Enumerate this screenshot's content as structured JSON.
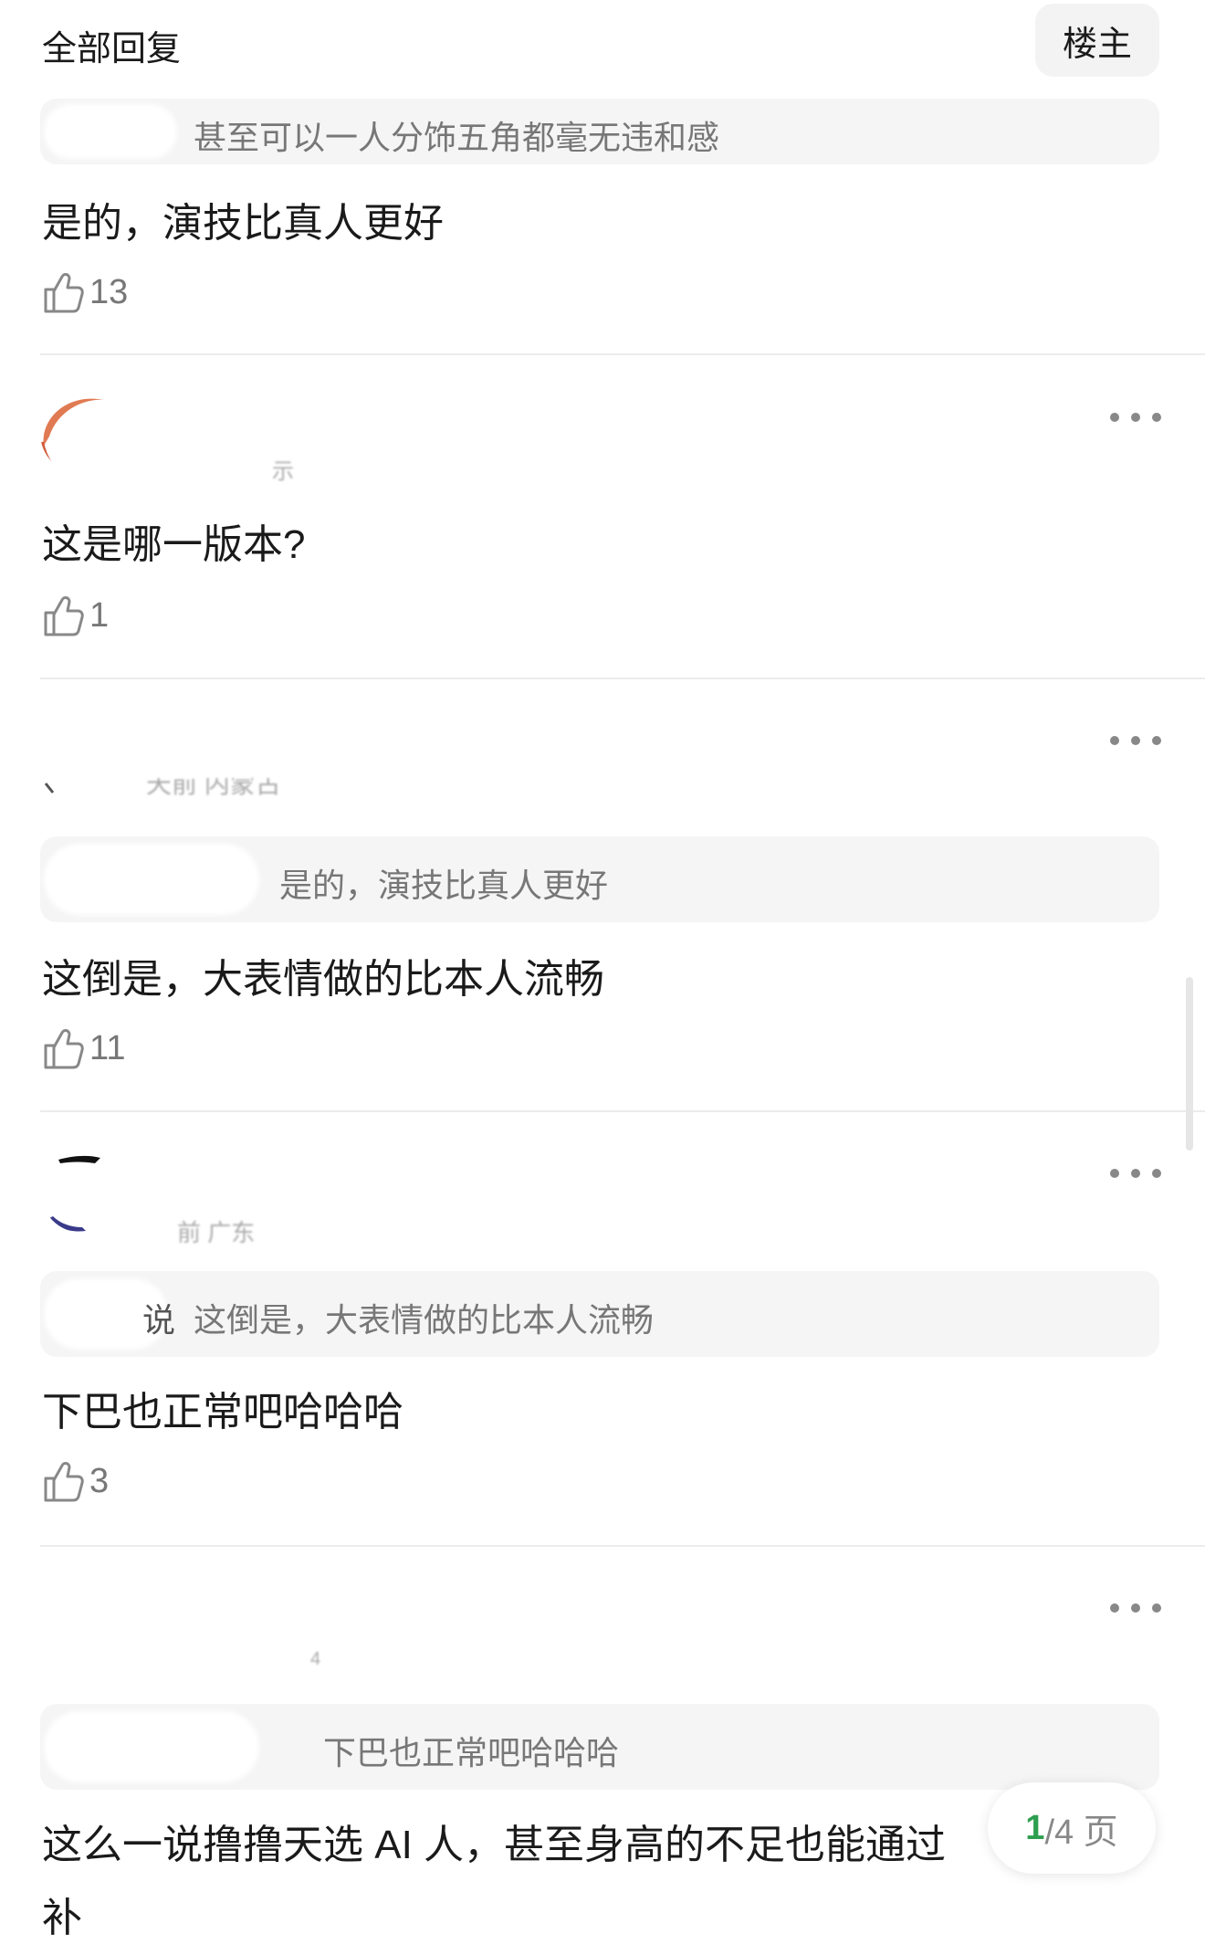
{
  "header": {
    "title": "全部回复",
    "owner_filter_label": "楼主"
  },
  "replies": [
    {
      "quote_text": "甚至可以一人分饰五角都毫无违和感",
      "body": "是的，演技比真人更好",
      "likes": "13"
    },
    {
      "name_fragment": "示",
      "body": "这是哪一版本?",
      "likes": "1"
    },
    {
      "name_fragment": "天前 内蒙古",
      "quote_text": "是的，演技比真人更好",
      "body": "这倒是，大表情做的比本人流畅",
      "likes": "11"
    },
    {
      "name_fragment": "前 广东",
      "quote_prefix": "说",
      "quote_text": "这倒是，大表情做的比本人流畅",
      "body": "下巴也正常吧哈哈哈",
      "likes": "3"
    },
    {
      "name_fragment": "4",
      "quote_text": "下巴也正常吧哈哈哈",
      "body_line1": "这么一说撸撸天选 AI 人，甚至身高的不足也能通过",
      "body_line2": "补"
    }
  ],
  "pager": {
    "current": "1",
    "total_text": "/4 页"
  },
  "colors": {
    "accent_green": "#2e9e4f",
    "quote_bg": "#f5f5f5",
    "secondary_text": "#777777"
  },
  "icons": {
    "like": "thumbs-up-icon",
    "more": "more-horizontal-icon"
  }
}
